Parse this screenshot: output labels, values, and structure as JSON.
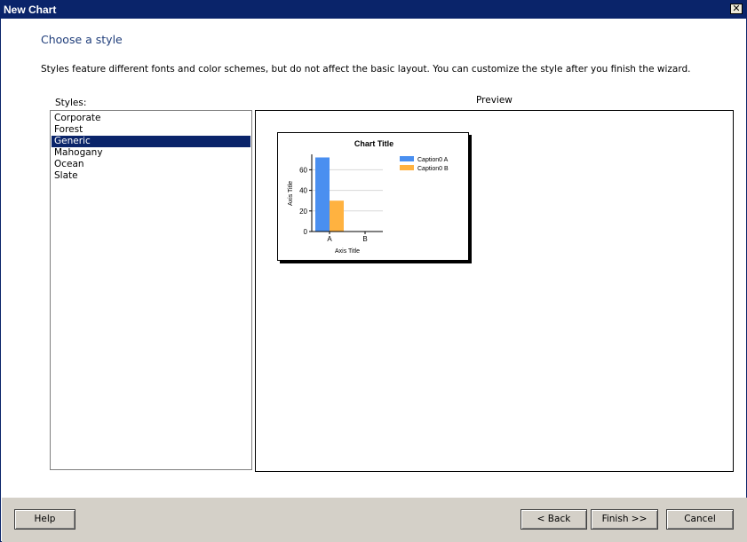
{
  "window": {
    "title": "New Chart",
    "close_glyph": "✕"
  },
  "page": {
    "heading": "Choose a style",
    "description": "Styles feature different fonts and color schemes, but do not affect the basic layout. You can customize the style after you finish the wizard.",
    "styles_label": "Styles:",
    "preview_label": "Preview"
  },
  "styles": {
    "items": [
      "Corporate",
      "Forest",
      "Generic",
      "Mahogany",
      "Ocean",
      "Slate"
    ],
    "selected": "Generic"
  },
  "colors": {
    "selection": "#0a246a",
    "series_a": "#4a8ff0",
    "series_b": "#ffb240",
    "footer": "#d4d0c8"
  },
  "chart_data": {
    "type": "bar",
    "title": "Chart Title",
    "xlabel": "Axis Title",
    "ylabel": "Axis Title",
    "categories": [
      "A",
      "B"
    ],
    "series": [
      {
        "name": "Caption0 A",
        "values": [
          72,
          0
        ]
      },
      {
        "name": "Caption0 B",
        "values": [
          30,
          0
        ]
      }
    ],
    "ylim": [
      0,
      75
    ],
    "yticks": [
      0,
      20,
      40,
      60
    ],
    "grid": true,
    "legend": "top-right"
  },
  "buttons": {
    "help": "Help",
    "back": "< Back",
    "finish": "Finish >>",
    "cancel": "Cancel"
  }
}
